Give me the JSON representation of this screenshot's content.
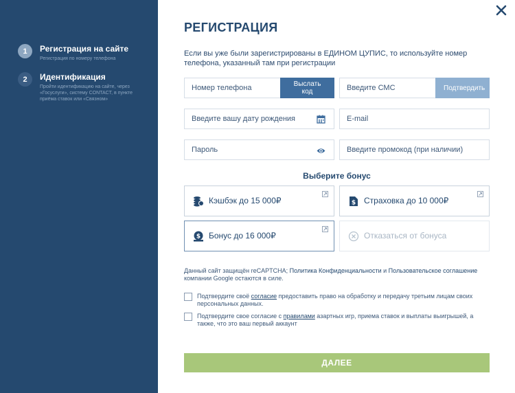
{
  "sidebar": {
    "steps": [
      {
        "num": "1",
        "title": "Регистрация на сайте",
        "subtitle": "Регистрация по номеру телефона"
      },
      {
        "num": "2",
        "title": "Идентификация",
        "subtitle": "Пройти идентификацию на сайте, через «Госуслуги», систему CONTACT, в пункте приёма ставок или «Связном»"
      }
    ]
  },
  "form": {
    "title": "РЕГИСТРАЦИЯ",
    "intro": "Если вы уже были зарегистрированы в ЕДИНОМ ЦУПИС, то используйте номер телефона, указанный там при регистрации",
    "phone_placeholder": "Номер телефона",
    "send_code_label": "Выслать код",
    "sms_placeholder": "Введите СМС",
    "confirm_label": "Подтвердить",
    "birthdate_placeholder": "Введите вашу дату рождения",
    "email_placeholder": "E-mail",
    "password_placeholder": "Пароль",
    "promo_placeholder": "Введите промокод (при наличии)"
  },
  "bonus": {
    "heading": "Выберите бонус",
    "options": [
      {
        "label": "Кэшбэк до 15 000₽",
        "icon": "coins-icon"
      },
      {
        "label": "Страховка до 10 000₽",
        "icon": "insurance-doc-icon"
      },
      {
        "label": "Бонус до 16 000₽",
        "icon": "money-bag-icon"
      },
      {
        "label": "Отказаться от бонуса",
        "icon": "cancel-circle-icon"
      }
    ]
  },
  "legal": {
    "recaptcha_prefix": "Данный сайт защищён reCAPTCHA; ",
    "privacy_link": "Политика Конфиденциальности",
    "and_text": " и ",
    "terms_link": "Пользовательское соглашение",
    "recaptcha_suffix": " компании Google остаются в силе.",
    "consent1_prefix": "Подтвердите своё ",
    "consent1_link": "согласие",
    "consent1_suffix": " предоставить право на обработку и передачу третьим лицам своих персональных данных.",
    "consent2_prefix": "Подтвердите свое согласие с ",
    "consent2_link": "правилами",
    "consent2_suffix": " азартных игр, приема ставок и выплаты выигрышей, а также, что это ваш первый аккаунт"
  },
  "submit_label": "ДАЛЕЕ",
  "colors": {
    "sidebar_bg": "#25496f",
    "primary_button": "#3f6d9e",
    "confirm_button": "#8fb0d1",
    "submit_button": "#a8c77a"
  }
}
